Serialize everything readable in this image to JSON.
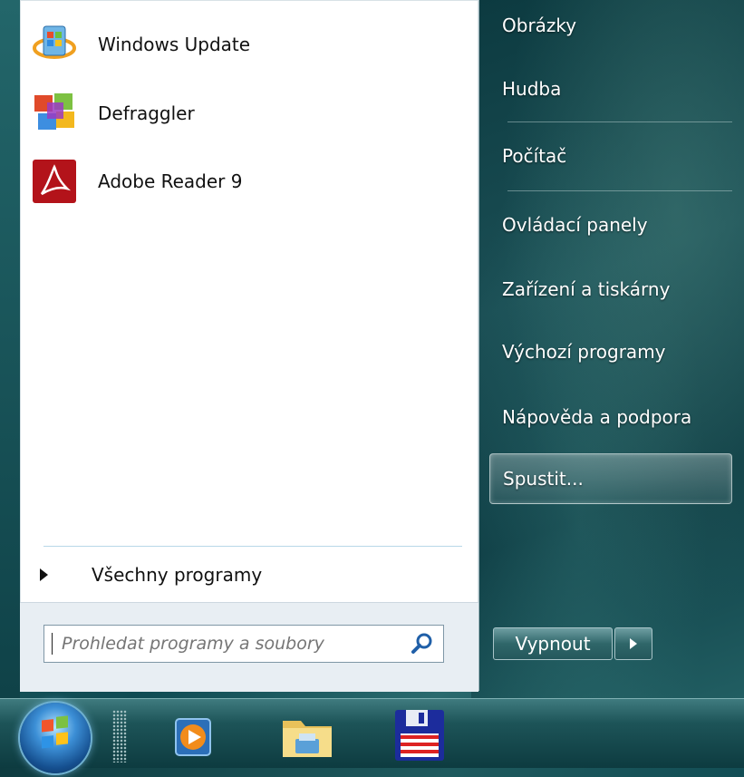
{
  "start_menu": {
    "pinned_programs": [
      {
        "label": "Windows Update",
        "icon": "windows-update-icon"
      },
      {
        "label": "Defraggler",
        "icon": "defraggler-icon"
      },
      {
        "label": "Adobe Reader 9",
        "icon": "adobe-reader-icon"
      }
    ],
    "all_programs_label": "Všechny programy",
    "search": {
      "placeholder": "Prohledat programy a soubory"
    },
    "right_pane": [
      {
        "label": "Obrázky"
      },
      {
        "label": "Hudba"
      },
      {
        "label": "Počítač"
      },
      {
        "label": "Ovládací panely"
      },
      {
        "label": "Zařízení a tiskárny"
      },
      {
        "label": "Výchozí programy"
      },
      {
        "label": "Nápověda a podpora"
      },
      {
        "label": "Spustit..."
      }
    ],
    "shutdown_label": "Vypnout"
  },
  "taskbar": {
    "items": [
      {
        "icon": "windows-start-orb-icon"
      },
      {
        "icon": "media-player-icon"
      },
      {
        "icon": "file-explorer-folder-icon"
      },
      {
        "icon": "floppy-disk-app-icon"
      }
    ]
  },
  "colors": {
    "accent": "#2f6669",
    "menu_bg": "#ffffff",
    "search_area": "#e8eef3"
  }
}
